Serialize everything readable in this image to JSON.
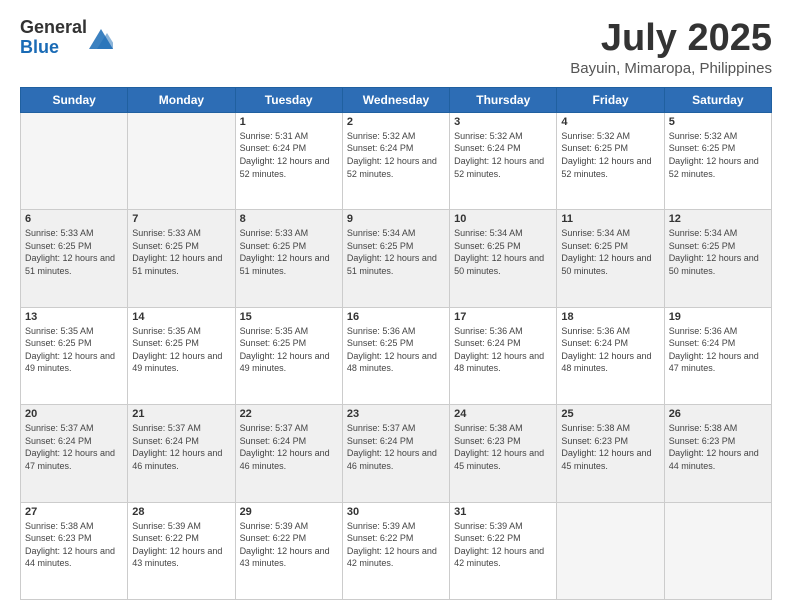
{
  "logo": {
    "general": "General",
    "blue": "Blue"
  },
  "header": {
    "month": "July 2025",
    "location": "Bayuin, Mimaropa, Philippines"
  },
  "weekdays": [
    "Sunday",
    "Monday",
    "Tuesday",
    "Wednesday",
    "Thursday",
    "Friday",
    "Saturday"
  ],
  "weeks": [
    [
      {
        "day": "",
        "info": ""
      },
      {
        "day": "",
        "info": ""
      },
      {
        "day": "1",
        "info": "Sunrise: 5:31 AM\nSunset: 6:24 PM\nDaylight: 12 hours and 52 minutes."
      },
      {
        "day": "2",
        "info": "Sunrise: 5:32 AM\nSunset: 6:24 PM\nDaylight: 12 hours and 52 minutes."
      },
      {
        "day": "3",
        "info": "Sunrise: 5:32 AM\nSunset: 6:24 PM\nDaylight: 12 hours and 52 minutes."
      },
      {
        "day": "4",
        "info": "Sunrise: 5:32 AM\nSunset: 6:25 PM\nDaylight: 12 hours and 52 minutes."
      },
      {
        "day": "5",
        "info": "Sunrise: 5:32 AM\nSunset: 6:25 PM\nDaylight: 12 hours and 52 minutes."
      }
    ],
    [
      {
        "day": "6",
        "info": "Sunrise: 5:33 AM\nSunset: 6:25 PM\nDaylight: 12 hours and 51 minutes."
      },
      {
        "day": "7",
        "info": "Sunrise: 5:33 AM\nSunset: 6:25 PM\nDaylight: 12 hours and 51 minutes."
      },
      {
        "day": "8",
        "info": "Sunrise: 5:33 AM\nSunset: 6:25 PM\nDaylight: 12 hours and 51 minutes."
      },
      {
        "day": "9",
        "info": "Sunrise: 5:34 AM\nSunset: 6:25 PM\nDaylight: 12 hours and 51 minutes."
      },
      {
        "day": "10",
        "info": "Sunrise: 5:34 AM\nSunset: 6:25 PM\nDaylight: 12 hours and 50 minutes."
      },
      {
        "day": "11",
        "info": "Sunrise: 5:34 AM\nSunset: 6:25 PM\nDaylight: 12 hours and 50 minutes."
      },
      {
        "day": "12",
        "info": "Sunrise: 5:34 AM\nSunset: 6:25 PM\nDaylight: 12 hours and 50 minutes."
      }
    ],
    [
      {
        "day": "13",
        "info": "Sunrise: 5:35 AM\nSunset: 6:25 PM\nDaylight: 12 hours and 49 minutes."
      },
      {
        "day": "14",
        "info": "Sunrise: 5:35 AM\nSunset: 6:25 PM\nDaylight: 12 hours and 49 minutes."
      },
      {
        "day": "15",
        "info": "Sunrise: 5:35 AM\nSunset: 6:25 PM\nDaylight: 12 hours and 49 minutes."
      },
      {
        "day": "16",
        "info": "Sunrise: 5:36 AM\nSunset: 6:25 PM\nDaylight: 12 hours and 48 minutes."
      },
      {
        "day": "17",
        "info": "Sunrise: 5:36 AM\nSunset: 6:24 PM\nDaylight: 12 hours and 48 minutes."
      },
      {
        "day": "18",
        "info": "Sunrise: 5:36 AM\nSunset: 6:24 PM\nDaylight: 12 hours and 48 minutes."
      },
      {
        "day": "19",
        "info": "Sunrise: 5:36 AM\nSunset: 6:24 PM\nDaylight: 12 hours and 47 minutes."
      }
    ],
    [
      {
        "day": "20",
        "info": "Sunrise: 5:37 AM\nSunset: 6:24 PM\nDaylight: 12 hours and 47 minutes."
      },
      {
        "day": "21",
        "info": "Sunrise: 5:37 AM\nSunset: 6:24 PM\nDaylight: 12 hours and 46 minutes."
      },
      {
        "day": "22",
        "info": "Sunrise: 5:37 AM\nSunset: 6:24 PM\nDaylight: 12 hours and 46 minutes."
      },
      {
        "day": "23",
        "info": "Sunrise: 5:37 AM\nSunset: 6:24 PM\nDaylight: 12 hours and 46 minutes."
      },
      {
        "day": "24",
        "info": "Sunrise: 5:38 AM\nSunset: 6:23 PM\nDaylight: 12 hours and 45 minutes."
      },
      {
        "day": "25",
        "info": "Sunrise: 5:38 AM\nSunset: 6:23 PM\nDaylight: 12 hours and 45 minutes."
      },
      {
        "day": "26",
        "info": "Sunrise: 5:38 AM\nSunset: 6:23 PM\nDaylight: 12 hours and 44 minutes."
      }
    ],
    [
      {
        "day": "27",
        "info": "Sunrise: 5:38 AM\nSunset: 6:23 PM\nDaylight: 12 hours and 44 minutes."
      },
      {
        "day": "28",
        "info": "Sunrise: 5:39 AM\nSunset: 6:22 PM\nDaylight: 12 hours and 43 minutes."
      },
      {
        "day": "29",
        "info": "Sunrise: 5:39 AM\nSunset: 6:22 PM\nDaylight: 12 hours and 43 minutes."
      },
      {
        "day": "30",
        "info": "Sunrise: 5:39 AM\nSunset: 6:22 PM\nDaylight: 12 hours and 42 minutes."
      },
      {
        "day": "31",
        "info": "Sunrise: 5:39 AM\nSunset: 6:22 PM\nDaylight: 12 hours and 42 minutes."
      },
      {
        "day": "",
        "info": ""
      },
      {
        "day": "",
        "info": ""
      }
    ]
  ]
}
